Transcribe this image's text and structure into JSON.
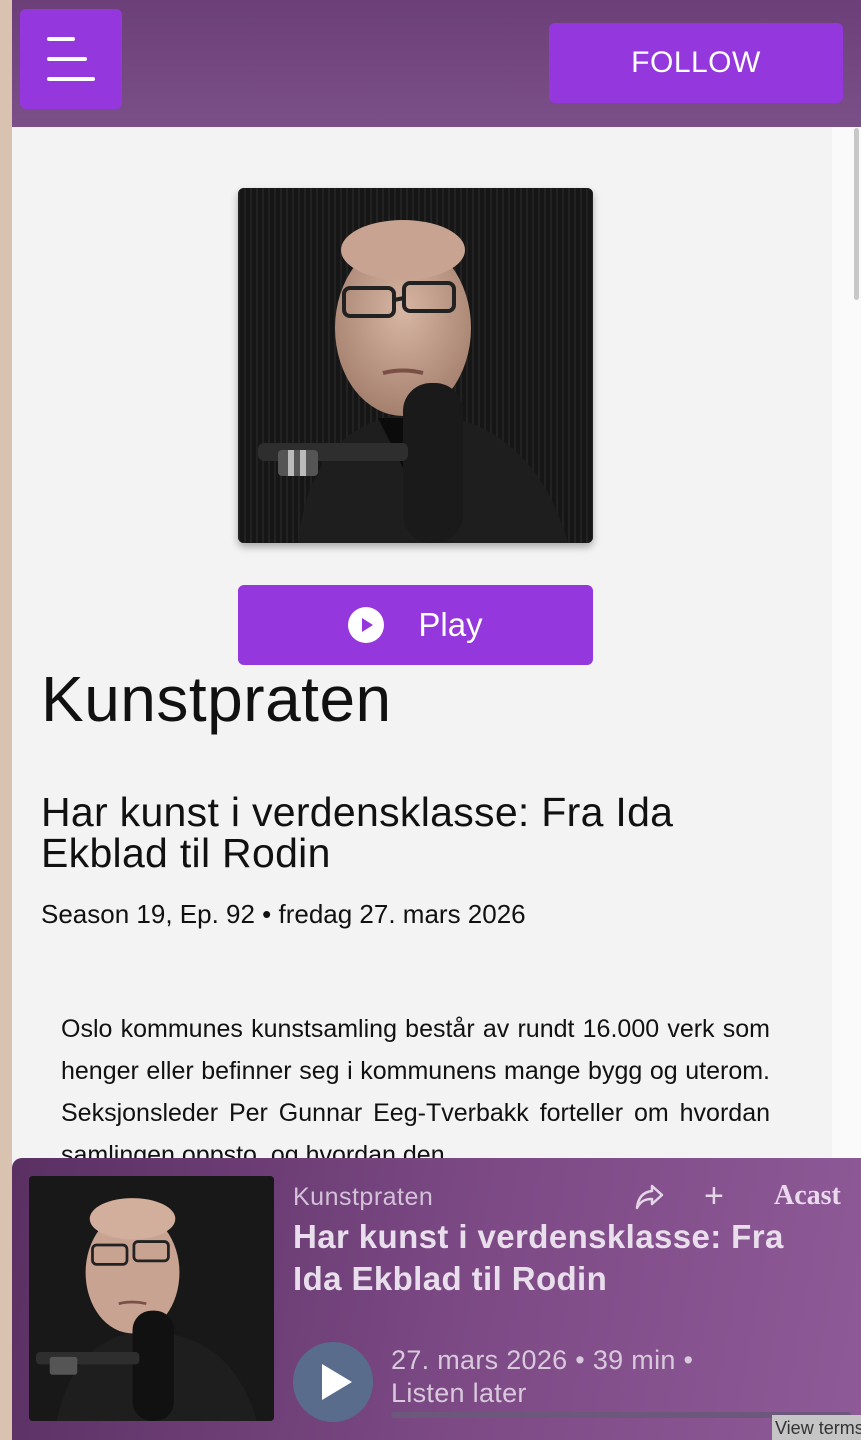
{
  "header": {
    "menu_icon": "hamburger-menu-icon",
    "follow_label": "FOLLOW"
  },
  "episode": {
    "cover_alt": "Kunstpraten episode cover",
    "play_label": "Play",
    "show_title": "Kunstpraten",
    "title": "Har kunst i verdensklasse: Fra Ida Ekblad til Rodin",
    "meta": "Season 19, Ep. 92 • fredag 27. mars 2026",
    "description": "Oslo kommunes kunstsamling består av rundt 16.000 verk som henger eller befinner seg i kommunens mange bygg og uterom. Seksjonsleder Per Gunnar Eeg-Tverbakk forteller om hvordan samlingen oppsto, og hvordan den"
  },
  "player": {
    "show": "Kunstpraten",
    "title": "Har kunst i verdensklasse: Fra Ida Ekblad til Rodin",
    "date_duration": "27. mars 2026 • 39 min •",
    "listen_later": "Listen later",
    "brand": "Acast",
    "add_label": "+",
    "view_terms": "View terms",
    "progress": 0
  },
  "colors": {
    "accent": "#9437dd",
    "header_bg": "#6c3f78",
    "player_bg": "#7d4a86"
  }
}
